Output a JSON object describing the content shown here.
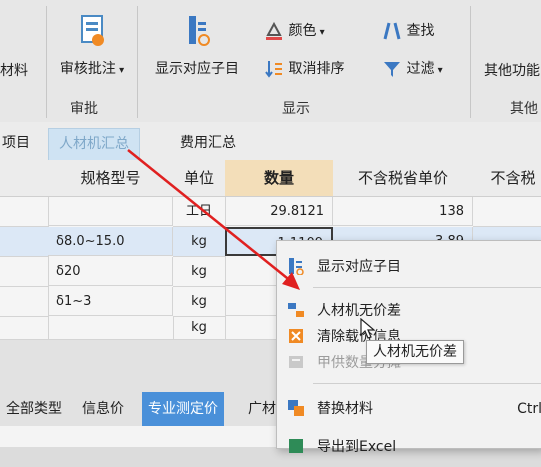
{
  "ribbon": {
    "left_partial_label": "材料",
    "audit": {
      "label": "审核批注",
      "icon": "audit-icon"
    },
    "show_child": {
      "label": "显示对应子目",
      "icon": "show-child-icon"
    },
    "color": {
      "label": "颜色",
      "icon": "color-icon"
    },
    "cancel_sort": {
      "label": "取消排序",
      "icon": "sort-icon"
    },
    "find": {
      "label": "查找",
      "icon": "find-icon"
    },
    "filter": {
      "label": "过滤",
      "icon": "filter-icon"
    },
    "other_func": {
      "label": "其他功能"
    },
    "groups": {
      "approve": "审批",
      "display": "显示",
      "other": "其他"
    }
  },
  "module_tabs": [
    "项目",
    "人材机汇总",
    "费用汇总"
  ],
  "grid": {
    "headers": [
      "规格型号",
      "单位",
      "数量",
      "不含税省单价",
      "不含税"
    ],
    "rows": [
      {
        "spec": "",
        "unit": "工日",
        "qty": "29.8121",
        "price": "138"
      },
      {
        "spec": "δ8.0~15.0",
        "unit": "kg",
        "qty": "1.1109",
        "price": "3.89"
      },
      {
        "spec": "δ20",
        "unit": "kg",
        "qty": "",
        "price": ""
      },
      {
        "spec": "δ1~3",
        "unit": "kg",
        "qty": "",
        "price": ""
      },
      {
        "spec": "",
        "unit": "kg",
        "qty": "",
        "price": ""
      }
    ]
  },
  "bottom_tabs": [
    "全部类型",
    "信息价",
    "专业测定价",
    "广材"
  ],
  "context_menu": {
    "items": [
      {
        "label": "显示对应子目",
        "icon": "show-child-icon",
        "enabled": true,
        "shortcut": ""
      },
      {
        "label": "人材机无价差",
        "icon": "no-price-diff-icon",
        "enabled": true,
        "shortcut": ""
      },
      {
        "label": "清除载价信息",
        "icon": "clear-icon",
        "enabled": true,
        "shortcut": ""
      },
      {
        "label": "甲供数量分摊",
        "icon": "supply-icon",
        "enabled": false,
        "shortcut": ""
      },
      {
        "label": "替换材料",
        "icon": "replace-icon",
        "enabled": true,
        "shortcut": "Ctrl"
      },
      {
        "label": "导出到Excel",
        "icon": "excel-icon",
        "enabled": true,
        "shortcut": ""
      }
    ],
    "tooltip": "人材机无价差"
  },
  "colors": {
    "accent_blue": "#4a90d9",
    "selected_header": "#f3deb9",
    "arrow": "#e02020"
  }
}
